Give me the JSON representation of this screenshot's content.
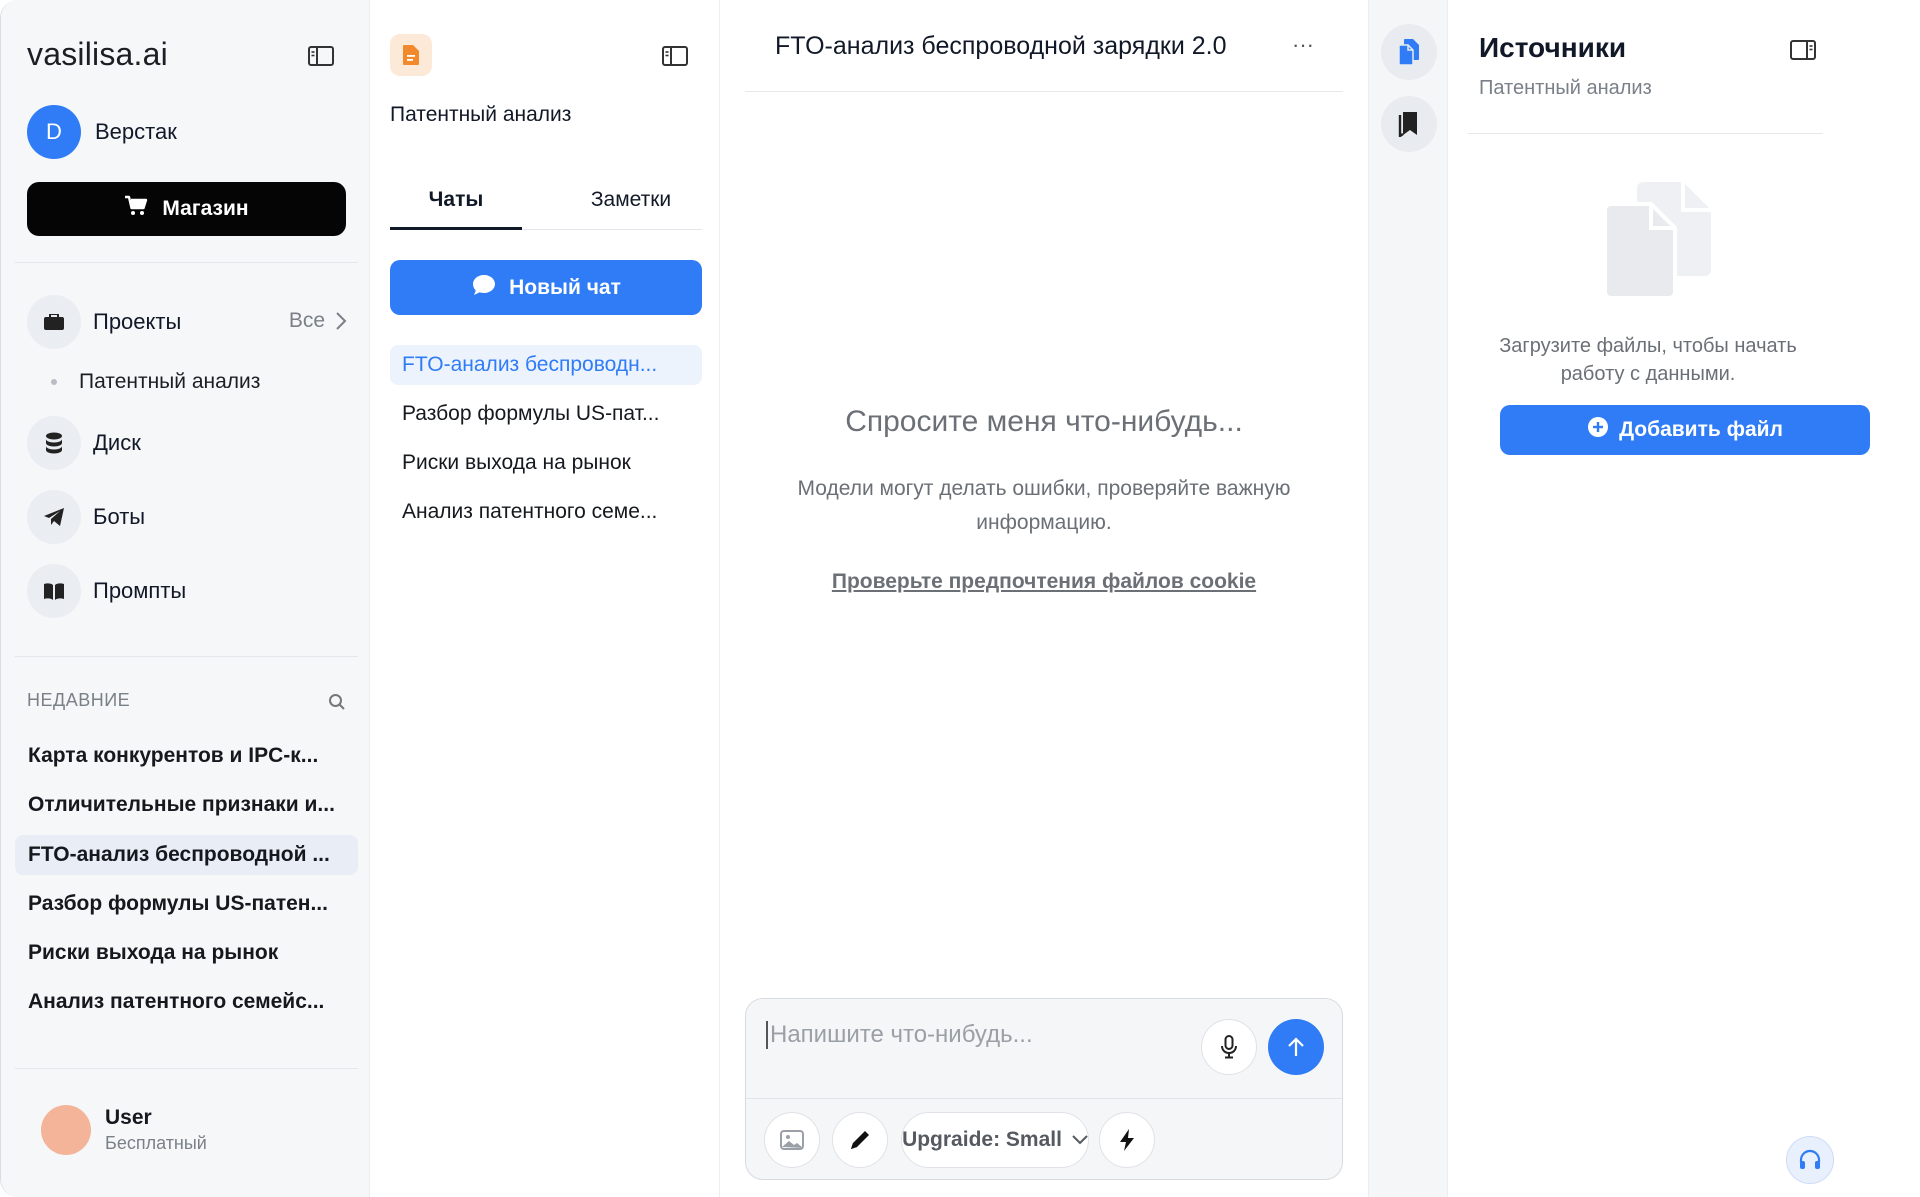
{
  "sidebar": {
    "brand": "vasilisa.ai",
    "workspace": {
      "initial": "D",
      "name": "Верстак"
    },
    "shop_label": "Магазин",
    "nav": {
      "projects": "Проекты",
      "projects_all": "Все",
      "project_sub": "Патентный анализ",
      "disk": "Диск",
      "bots": "Боты",
      "prompts": "Промпты"
    },
    "recent_heading": "НЕДАВНИЕ",
    "recent": [
      "Карта конкурентов и IPC-к...",
      "Отличительные признаки и...",
      "FTO-анализ беспроводной ...",
      "Разбор формулы US-патен...",
      "Риски выхода на рынок",
      "Анализ патентного семейс..."
    ],
    "user": {
      "name": "User",
      "plan": "Бесплатный"
    }
  },
  "project": {
    "title": "Патентный анализ",
    "tabs": [
      "Чаты",
      "Заметки"
    ],
    "new_chat_label": "Новый чат",
    "chats": [
      "FTO-анализ беспроводн...",
      "Разбор формулы US-пат...",
      "Риски выхода на рынок",
      "Анализ патентного семе..."
    ]
  },
  "chat": {
    "title": "FTO-анализ беспроводной зарядки 2.0",
    "more": "···",
    "empty_title": "Спросите меня что-нибудь...",
    "empty_sub": "Модели могут делать ошибки, проверяйте важную информацию.",
    "cookie_link": "Проверьте предпочтения файлов cookie",
    "input_placeholder": "Напишите что-нибудь...",
    "model_label": "Upgraide: Small"
  },
  "sources": {
    "title": "Источники",
    "subtitle": "Патентный анализ",
    "empty_text": "Загрузите файлы, чтобы начать работу с данными.",
    "add_file_label": "Добавить файл"
  },
  "colors": {
    "accent": "#2f7cf6",
    "sidebar_bg": "#f6f7f9",
    "shop_bg": "#050505",
    "active_chat_bg": "#edf3fd",
    "project_icon": "#f08a2c"
  },
  "icons": {
    "sidebar_toggle": "sidebar-toggle-icon",
    "cart": "cart-icon",
    "projects": "briefcase-icon",
    "disk": "database-icon",
    "bots": "telegram-icon",
    "prompts": "book-icon",
    "search": "search-icon",
    "chat_bubble": "chat-bubble-icon",
    "mic": "mic-icon",
    "send": "arrow-up-icon",
    "image": "image-icon",
    "pen": "pen-icon",
    "bolt": "bolt-icon",
    "chevron": "chevron-down-icon",
    "documents": "documents-icon",
    "bookmark": "bookmark-icon",
    "plus": "plus-circle-icon",
    "headset": "headset-icon"
  }
}
